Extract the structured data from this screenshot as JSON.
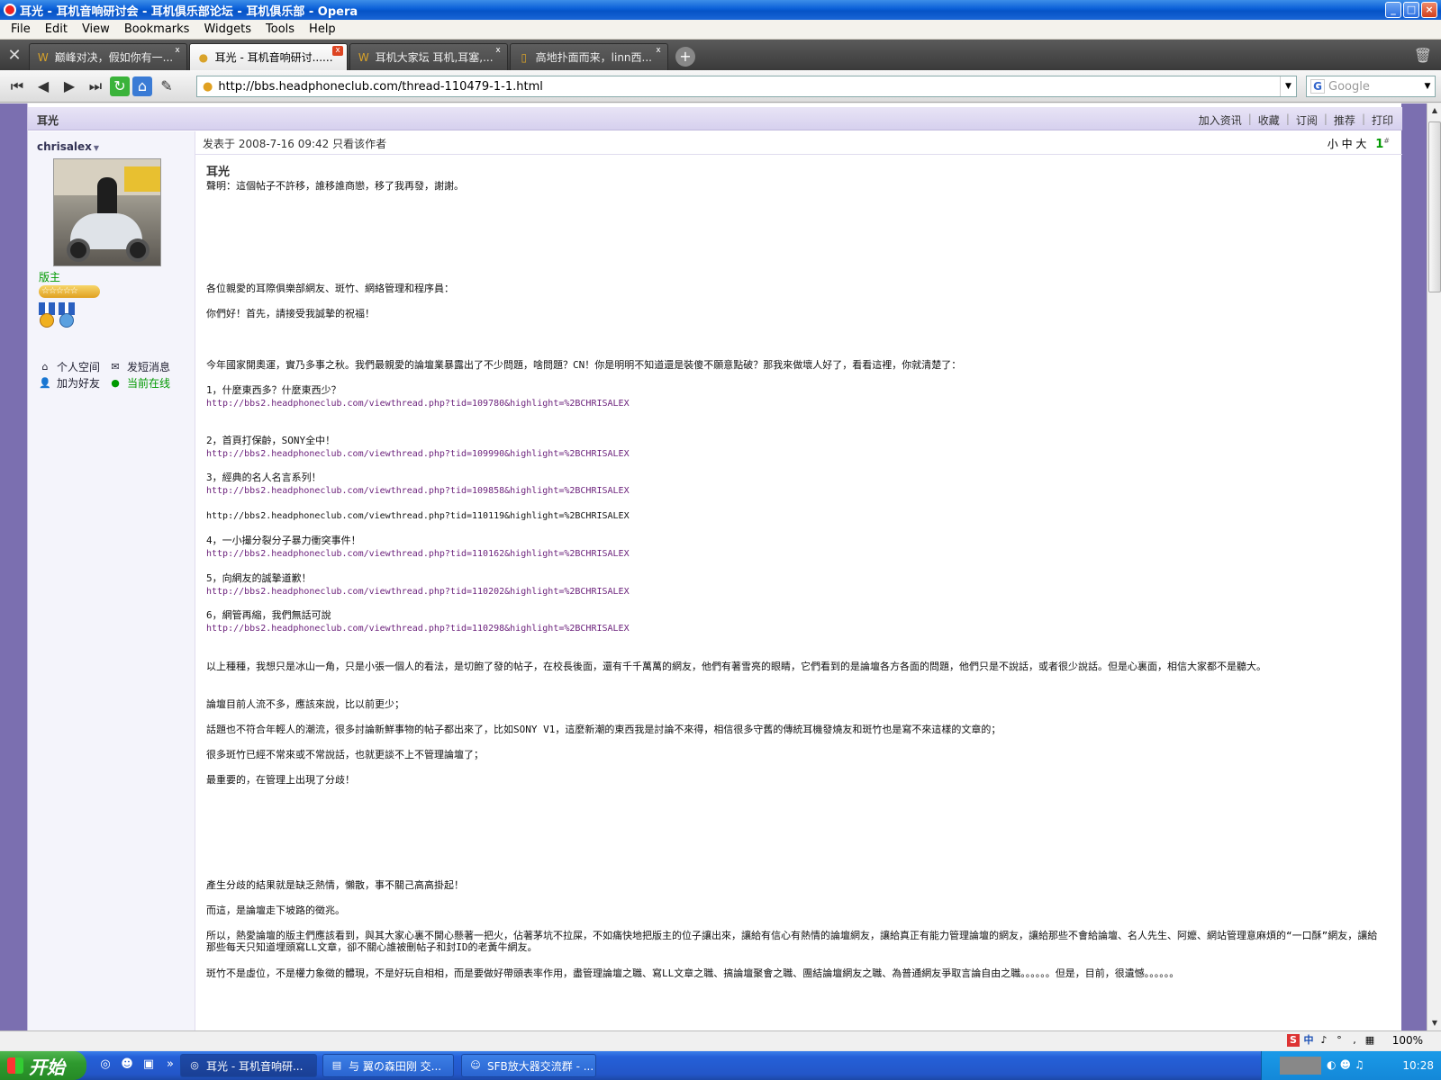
{
  "window": {
    "title": "耳光 - 耳机音响研讨会 - 耳机俱乐部论坛 - 耳机俱乐部 - Opera",
    "min": "_",
    "max": "□",
    "close": "×"
  },
  "menu": [
    "File",
    "Edit",
    "View",
    "Bookmarks",
    "Widgets",
    "Tools",
    "Help"
  ],
  "tabs": [
    {
      "label": "巅峰对决，假如你有一...",
      "icon": "W",
      "active": false
    },
    {
      "label": "耳光 - 耳机音响研讨......",
      "icon": "●",
      "active": true
    },
    {
      "label": "耳机大家坛 耳机,耳塞,...",
      "icon": "W",
      "active": false
    },
    {
      "label": "高地扑面而来，linn西...",
      "icon": "▯",
      "active": false
    }
  ],
  "tab_close": "x",
  "new_tab": "+",
  "address": {
    "url": "http://bbs.headphoneclub.com/thread-110479-1-1.html",
    "search_placeholder": "Google",
    "search_logo": "G",
    "dropdown": "▼"
  },
  "post": {
    "header_title": "耳光",
    "actions": [
      "加入资讯",
      "收藏",
      "订阅",
      "推荐",
      "打印"
    ],
    "author": "chrisalex",
    "author_menu": "▼",
    "rank": "版主",
    "stars": "☆☆☆☆☆",
    "links": {
      "space": "个人空间",
      "message": "发短消息",
      "add_friend": "加为好友",
      "online": "当前在线"
    },
    "meta": "发表于 2008-7-16 09:42  只看该作者",
    "font_sizes": [
      "小",
      "中",
      "大"
    ],
    "floor": "1",
    "floor_suffix": "#",
    "title": "耳光",
    "paragraphs": [
      {
        "text": "聲明：這個帖子不許移，誰移誰商戀，移了我再發，謝謝。"
      },
      {
        "text": "各位親愛的耳際俱樂部網友、斑竹、網絡管理和程序員："
      },
      {
        "text": "你們好！首先，請接受我誠摯的祝福！"
      },
      {
        "text": "今年國家開奧運，實乃多事之秋。我們最親愛的論壇業暴露出了不少問題，啥問題？CN！你是明明不知道還是裝傻不願意點破？那我來做壞人好了，看看這裡，你就清楚了："
      },
      {
        "text": "1，什麼東西多？什麼東西少？"
      },
      {
        "link": "http://bbs2.headphoneclub.com/viewthread.php?tid=109780&highlight=%2BCHRISALEX"
      },
      {
        "text": "2，首頁打保齡，SONY全中！"
      },
      {
        "link": "http://bbs2.headphoneclub.com/viewthread.php?tid=109990&highlight=%2BCHRISALEX"
      },
      {
        "text": "3，經典的名人名言系列！"
      },
      {
        "link": "http://bbs2.headphoneclub.com/viewthread.php?tid=109858&highlight=%2BCHRISALEX"
      },
      {
        "plain": "http://bbs2.headphoneclub.com/viewthread.php?tid=110119&highlight=%2BCHRISALEX"
      },
      {
        "text": "4，一小撮分裂分子暴力衝突事件！"
      },
      {
        "link": "http://bbs2.headphoneclub.com/viewthread.php?tid=110162&highlight=%2BCHRISALEX"
      },
      {
        "text": "5，向網友的誠摯道歉！"
      },
      {
        "link": "http://bbs2.headphoneclub.com/viewthread.php?tid=110202&highlight=%2BCHRISALEX"
      },
      {
        "text": "6，網管再縮，我們無話可說"
      },
      {
        "link": "http://bbs2.headphoneclub.com/viewthread.php?tid=110298&highlight=%2BCHRISALEX"
      },
      {
        "text": "以上種種，我想只是冰山一角，只是小張一個人的看法，是切飽了發的帖子，在校長後面，還有千千萬萬的網友，他們有著雪亮的眼睛，它們看到的是論壇各方各面的問題，他們只是不說話，或者很少說話。但是心裏面，相信大家都不是聽大。"
      },
      {
        "text": "論壇目前人流不多，應該來說，比以前更少；"
      },
      {
        "text": "話題也不符合年輕人的潮流，很多討論新鮮事物的帖子都出來了，比如SONY V1，這麼新潮的東西我是討論不來得，相信很多守舊的傳統耳機發燒友和斑竹也是寫不來這樣的文章的；"
      },
      {
        "text": "很多斑竹已經不常來或不常說話，也就更談不上不管理論壇了；"
      },
      {
        "text": "最重要的，在管理上出現了分歧！"
      },
      {
        "text": "產生分歧的結果就是缺乏熱情，懶散，事不關己高高掛起！"
      },
      {
        "text": "而這，是論壇走下坡路的徵兆。"
      },
      {
        "text": "所以，熱愛論壇的版主們應該看到，與其大家心裏不開心懸著一把火，佔著茅坑不拉屎，不如痛快地把版主的位子讓出來，讓給有信心有熱情的論壇網友，讓給真正有能力管理論壇的網友，讓給那些不會給論壇、名人先生、阿嬤、網站管理意麻煩的“一口酥”網友，讓給那些每天只知道埋頭寫LL文章，卻不關心誰被刪帖子和封ID的老黃牛網友。"
      },
      {
        "text": "斑竹不是虛位，不是權力象徵的體現，不是好玩自相相，而是要做好帶頭表率作用，盡管理論壇之職、寫LL文章之職、搞論壇聚會之職、團結論壇網友之職、為普通網友爭取言論自由之職。。。。。。但是，目前，很遺憾。。。。。。"
      }
    ]
  },
  "status": {
    "zoom": "100%",
    "ime": [
      "S",
      "中",
      "♪",
      "°",
      ",",
      "▦"
    ]
  },
  "taskbar": {
    "start": "开始",
    "buttons": [
      {
        "label": "耳光 - 耳机音响研...",
        "active": true
      },
      {
        "label": "与  翼の森田刚 交...",
        "active": false
      },
      {
        "label": "SFB放大器交流群 - ...",
        "active": false
      }
    ],
    "clock": "10:28"
  }
}
